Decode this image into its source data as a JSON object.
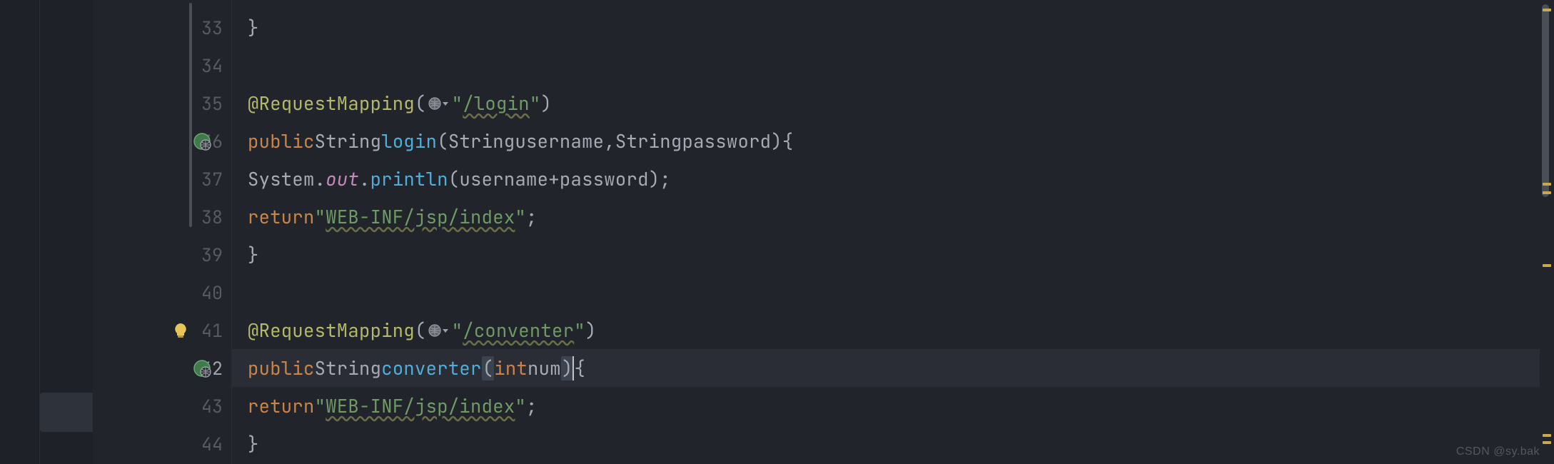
{
  "watermark": "CSDN @sy.bak",
  "gutter": {
    "lines": [
      "33",
      "34",
      "35",
      "36",
      "37",
      "38",
      "39",
      "40",
      "41",
      "42",
      "43",
      "44"
    ],
    "current": 42,
    "web_icon_lines": [
      36,
      42
    ],
    "bulb_line": 41
  },
  "code": {
    "33": {
      "indent": 2,
      "tokens": [
        [
          "pn",
          "}"
        ]
      ]
    },
    "34": {
      "indent": 0,
      "tokens": []
    },
    "35": {
      "indent": 2,
      "tokens": [
        [
          "ann",
          "@RequestMapping"
        ],
        [
          "pn",
          "("
        ],
        [
          "globe",
          ""
        ],
        [
          "str",
          "\""
        ],
        [
          "str-u",
          "/login"
        ],
        [
          "str",
          "\""
        ],
        [
          "pn",
          ")"
        ]
      ]
    },
    "36": {
      "indent": 2,
      "tokens": [
        [
          "kw",
          "public"
        ],
        [
          "sp",
          " "
        ],
        [
          "type",
          "String"
        ],
        [
          "sp",
          " "
        ],
        [
          "fn",
          "login"
        ],
        [
          "pn",
          "("
        ],
        [
          "type",
          "String"
        ],
        [
          "sp",
          " "
        ],
        [
          "id",
          "username"
        ],
        [
          "pn",
          ","
        ],
        [
          "type",
          "String"
        ],
        [
          "sp",
          " "
        ],
        [
          "id",
          "password"
        ],
        [
          "pn",
          ")"
        ],
        [
          "pn",
          "{"
        ]
      ]
    },
    "37": {
      "indent": 3,
      "tokens": [
        [
          "id",
          "System"
        ],
        [
          "pn",
          "."
        ],
        [
          "sysout",
          "out"
        ],
        [
          "pn",
          "."
        ],
        [
          "fn",
          "println"
        ],
        [
          "pn",
          "("
        ],
        [
          "id",
          "username"
        ],
        [
          "sp",
          " "
        ],
        [
          "pn",
          "+"
        ],
        [
          "sp",
          " "
        ],
        [
          "id",
          "password"
        ],
        [
          "pn",
          ")"
        ],
        [
          "pn",
          ";"
        ]
      ]
    },
    "38": {
      "indent": 3,
      "tokens": [
        [
          "kw",
          "return"
        ],
        [
          "sp",
          " "
        ],
        [
          "str",
          "\""
        ],
        [
          "str-u",
          "WEB-INF/jsp/index"
        ],
        [
          "str",
          "\""
        ],
        [
          "pn",
          ";"
        ]
      ]
    },
    "39": {
      "indent": 2,
      "tokens": [
        [
          "pn",
          "}"
        ]
      ]
    },
    "40": {
      "indent": 0,
      "tokens": []
    },
    "41": {
      "indent": 2,
      "tokens": [
        [
          "ann",
          "@RequestMapping"
        ],
        [
          "pn",
          "("
        ],
        [
          "globe",
          ""
        ],
        [
          "str",
          "\""
        ],
        [
          "str-u",
          "/conventer"
        ],
        [
          "str",
          "\""
        ],
        [
          "pn",
          ")"
        ]
      ]
    },
    "42": {
      "indent": 2,
      "current": true,
      "tokens": [
        [
          "kw",
          "public"
        ],
        [
          "sp",
          " "
        ],
        [
          "type",
          "String"
        ],
        [
          "sp",
          " "
        ],
        [
          "fn",
          "converter"
        ],
        [
          "brhl",
          "("
        ],
        [
          "kw",
          "int"
        ],
        [
          "sp",
          " "
        ],
        [
          "param",
          "num"
        ],
        [
          "brhl",
          ")"
        ],
        [
          "caret",
          ""
        ],
        [
          "sp",
          " "
        ],
        [
          "pn",
          "{"
        ]
      ]
    },
    "43": {
      "indent": 3,
      "tokens": [
        [
          "kw",
          "return"
        ],
        [
          "sp",
          " "
        ],
        [
          "str",
          "\""
        ],
        [
          "str-u",
          "WEB-INF/jsp/index"
        ],
        [
          "str",
          "\""
        ],
        [
          "pn",
          ";"
        ]
      ]
    },
    "44": {
      "indent": 2,
      "tokens": [
        [
          "pn",
          "}"
        ]
      ]
    }
  },
  "markers": [
    {
      "pos": 12,
      "kind": "y"
    },
    {
      "pos": 256,
      "kind": "y"
    },
    {
      "pos": 268,
      "kind": "y"
    },
    {
      "pos": 370,
      "kind": "y"
    },
    {
      "pos": 608,
      "kind": "y"
    },
    {
      "pos": 618,
      "kind": "y"
    }
  ],
  "colors": {
    "bg": "#21242b",
    "kw": "#c9844a",
    "fn": "#4faed8",
    "ann": "#b4b86b",
    "str": "#6f9a65",
    "id": "#a6aab3",
    "sysout": "#c08bb6"
  }
}
